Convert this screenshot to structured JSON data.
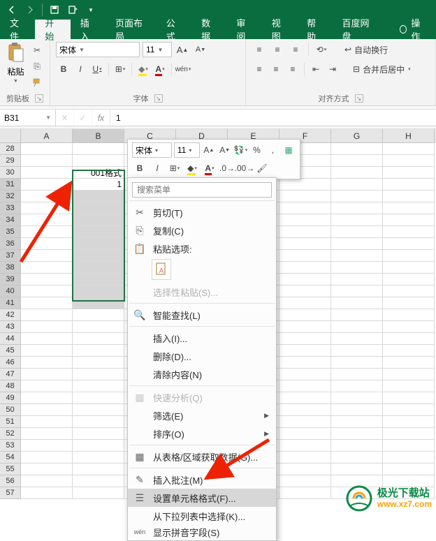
{
  "titlebar": {
    "icons": [
      "arrow-left",
      "arrow-right",
      "save",
      "new"
    ]
  },
  "tabs": {
    "items": [
      "文件",
      "开始",
      "插入",
      "页面布局",
      "公式",
      "数据",
      "审阅",
      "视图",
      "帮助",
      "百度网盘"
    ],
    "tell": "操作",
    "active_index": 1
  },
  "ribbon": {
    "clipboard": {
      "label": "剪贴板",
      "paste": "粘贴"
    },
    "font": {
      "label": "字体",
      "name": "宋体",
      "size": "11",
      "buttons": {
        "B": "B",
        "I": "I",
        "U": "U",
        "border": "⊞",
        "fill": "◇",
        "color": "A",
        "wen": "wén"
      }
    },
    "align": {
      "label": "对齐方式",
      "wrap": "自动换行",
      "merge": "合并后居中"
    }
  },
  "formula_bar": {
    "namebox": "B31",
    "fx": "fx",
    "value": "1",
    "btn_x": "✕",
    "btn_v": "✓"
  },
  "grid": {
    "cols": [
      "A",
      "B",
      "C",
      "D",
      "E",
      "F",
      "G",
      "H"
    ],
    "first_row": 28,
    "last_row": 57,
    "header_text": "001格式",
    "active_value": "1"
  },
  "minitb": {
    "name": "宋体",
    "size": "11",
    "accounting": "%",
    "comma": ","
  },
  "ctx": {
    "search_ph": "搜索菜单",
    "items": [
      {
        "k": "cut",
        "icon": "✂",
        "label": "剪切(T)"
      },
      {
        "k": "copy",
        "icon": "⎘",
        "label": "复制(C)"
      },
      {
        "k": "paste_hdr",
        "header": true,
        "icon": "📋",
        "label": "粘贴选项:"
      },
      {
        "k": "paste_icons",
        "paste": true
      },
      {
        "k": "paste_sp",
        "label": "选择性粘贴(S)...",
        "disabled": true
      },
      {
        "k": "sep1",
        "sep": true
      },
      {
        "k": "smart",
        "icon": "🔍",
        "label": "智能查找(L)"
      },
      {
        "k": "sep2",
        "sep": true
      },
      {
        "k": "insert",
        "label": "插入(I)..."
      },
      {
        "k": "delete",
        "label": "删除(D)..."
      },
      {
        "k": "clear",
        "label": "清除内容(N)"
      },
      {
        "k": "sep3",
        "sep": true
      },
      {
        "k": "quick",
        "icon": "▦",
        "label": "快速分析(Q)",
        "disabled": true
      },
      {
        "k": "filter",
        "label": "筛选(E)",
        "submenu": true
      },
      {
        "k": "sort",
        "label": "排序(O)",
        "submenu": true
      },
      {
        "k": "sep4",
        "sep": true
      },
      {
        "k": "table",
        "icon": "▦",
        "label": "从表格/区域获取数据(G)..."
      },
      {
        "k": "sep5",
        "sep": true
      },
      {
        "k": "comment",
        "icon": "✎",
        "label": "插入批注(M)"
      },
      {
        "k": "format",
        "icon": "☰",
        "label": "设置单元格格式(F)...",
        "hover": true
      },
      {
        "k": "dropdown",
        "label": "从下拉列表中选择(K)..."
      },
      {
        "k": "pinyin",
        "icon": "wén",
        "label": "显示拼音字段(S)",
        "cut": true
      }
    ]
  },
  "watermark": {
    "cn": "极光下载站",
    "en": "www.xz7.com"
  }
}
